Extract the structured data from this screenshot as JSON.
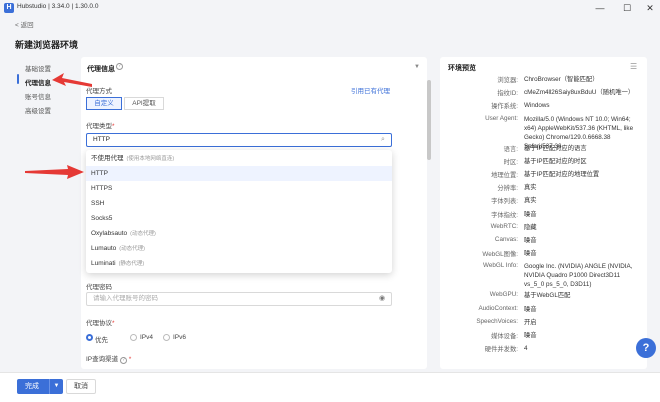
{
  "window": {
    "title": "Hubstudio | 3.34.0 | 1.30.0.0",
    "logo_text": "H",
    "min_icon": "—",
    "max_icon": "☐",
    "close_icon": "✕"
  },
  "header": {
    "back_label": "< 返回",
    "page_title": "新建浏览器环境"
  },
  "sidebar": {
    "items": [
      {
        "label": "基础设置"
      },
      {
        "label": "代理信息"
      },
      {
        "label": "账号信息"
      },
      {
        "label": "高级设置"
      }
    ]
  },
  "proxy": {
    "section_title": "代理信息",
    "proxy_method_label": "代理方式",
    "reuse_link": "引用已有代理",
    "method_tabs": [
      {
        "label": "自定义"
      },
      {
        "label": "API提取"
      }
    ],
    "type_label": "代理类型",
    "selected_type": "HTTP",
    "options": [
      {
        "label": "不使用代理",
        "note": "(使用本地网络直连)"
      },
      {
        "label": "HTTP",
        "note": ""
      },
      {
        "label": "HTTPS",
        "note": ""
      },
      {
        "label": "SSH",
        "note": ""
      },
      {
        "label": "Socks5",
        "note": ""
      },
      {
        "label": "Oxylabsauto",
        "note": "(动态代理)"
      },
      {
        "label": "Lumauto",
        "note": "(动态代理)"
      },
      {
        "label": "Luminati",
        "note": "(静态代理)"
      }
    ],
    "password_label": "代理密码",
    "password_placeholder": "请输入代理账号的密码",
    "protocol_label": "代理协议",
    "protocols": [
      {
        "label": "优先"
      },
      {
        "label": "IPv4"
      },
      {
        "label": "IPv6"
      }
    ],
    "protocol_selected_index": 0,
    "ip_channel_label": "IP查询渠道",
    "required_mark": "*"
  },
  "preview": {
    "title": "环境预览",
    "rows": [
      {
        "key": "浏览器:",
        "value": "ChroBrowser（智能匹配）"
      },
      {
        "key": "指纹ID:",
        "value": "cMeZm4ll26Saiy8uxBduU（随机唯一）"
      },
      {
        "key": "操作系统:",
        "value": "Windows"
      },
      {
        "key": "User Agent:",
        "value": "Mozilla/5.0 (Windows NT 10.0; Win64; x64) AppleWebKit/537.36 (KHTML, like Gecko) Chrome/129.0.6668.38 Safari/537.36"
      },
      {
        "key": "语言:",
        "value": "基于IP匹配对应的语言"
      },
      {
        "key": "时区:",
        "value": "基于IP匹配对应的时区"
      },
      {
        "key": "地理位置:",
        "value": "基于IP匹配对应的地理位置"
      },
      {
        "key": "分辨率:",
        "value": "真实"
      },
      {
        "key": "字体列表:",
        "value": "真实"
      },
      {
        "key": "字体指纹:",
        "value": "噪音"
      },
      {
        "key": "WebRTC:",
        "value": "隐藏"
      },
      {
        "key": "Canvas:",
        "value": "噪音"
      },
      {
        "key": "WebGL图像:",
        "value": "噪音"
      },
      {
        "key": "WebGL Info:",
        "value": "Google Inc. (NVIDIA) ANGLE (NVIDIA, NVIDIA Quadro P1000 Direct3D11 vs_5_0 ps_5_0, D3D11)"
      },
      {
        "key": "WebGPU:",
        "value": "基于WebGL匹配"
      },
      {
        "key": "AudioContext:",
        "value": "噪音"
      },
      {
        "key": "SpeechVoices:",
        "value": "开启"
      },
      {
        "key": "媒体设备:",
        "value": "噪音"
      },
      {
        "key": "硬件并发数:",
        "value": "4"
      }
    ]
  },
  "footer": {
    "complete_label": "完成",
    "cancel_label": "取消"
  },
  "help": {
    "label": "?"
  },
  "colors": {
    "accent": "#3b6fd8",
    "arrow": "#e53935"
  }
}
